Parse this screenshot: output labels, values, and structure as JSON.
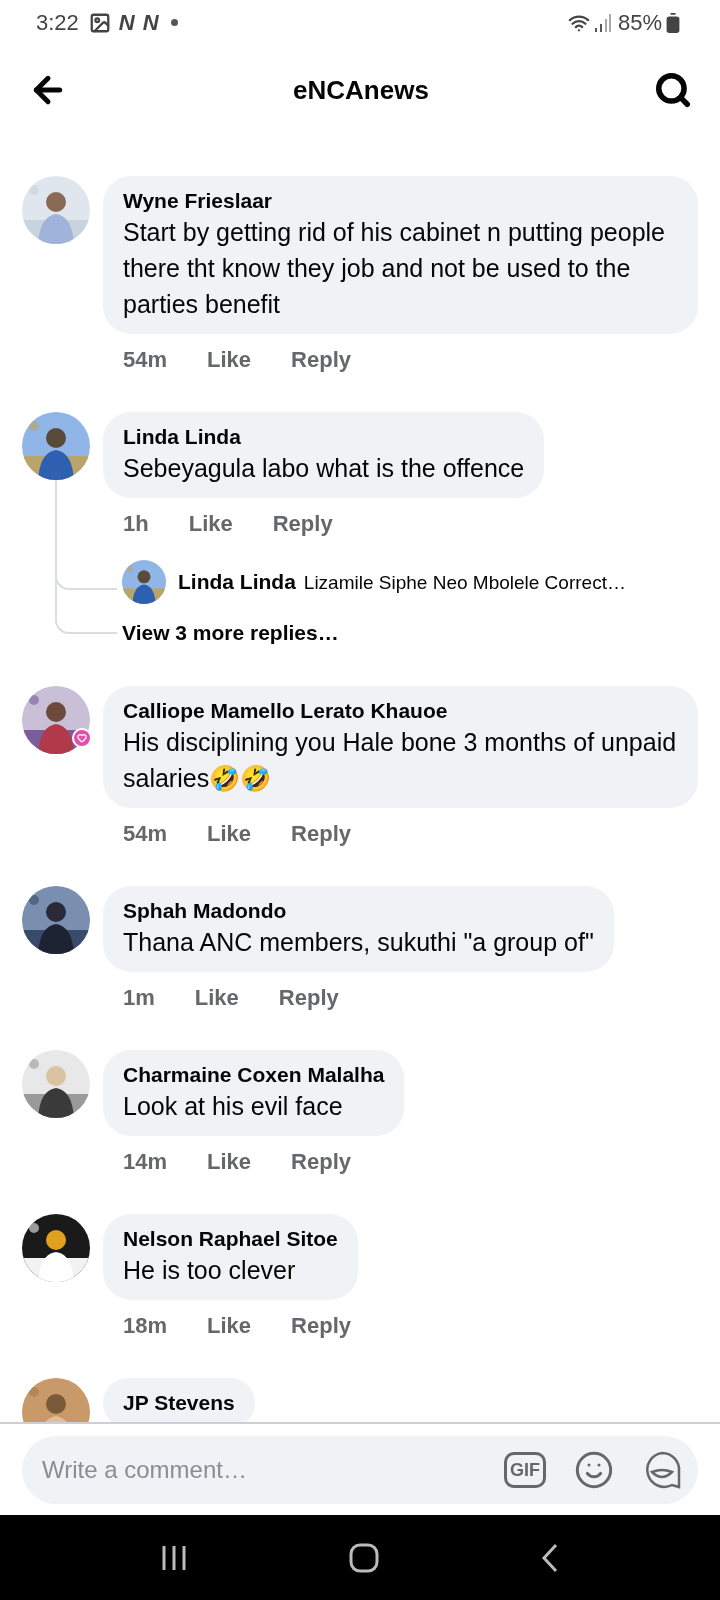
{
  "status_bar": {
    "time": "3:22",
    "notifications": [
      "N",
      "N"
    ],
    "battery": "85%"
  },
  "header": {
    "title": "eNCAnews"
  },
  "comments": [
    {
      "kind": "comment",
      "name": "Wyne Frieslaar",
      "text": "Start by getting rid of his cabinet n putting people there tht know they job and not be used to the parties benefit",
      "time": "54m",
      "like": "Like",
      "reply": "Reply",
      "heart_badge": false
    },
    {
      "kind": "thread",
      "name": "Linda Linda",
      "text": "Sebeyagula labo what is the offence",
      "time": "1h",
      "like": "Like",
      "reply": "Reply",
      "heart_badge": false,
      "replies": [
        {
          "name": "Linda Linda",
          "text": "Lizamile Siphe Neo Mbolele Correct…"
        }
      ],
      "more_replies": "View 3 more replies…"
    },
    {
      "kind": "comment",
      "name": "Calliope Mamello Lerato Khauoe",
      "text": "His disciplining you Hale bone 3 months of unpaid salaries🤣🤣",
      "time": "54m",
      "like": "Like",
      "reply": "Reply",
      "heart_badge": true
    },
    {
      "kind": "comment",
      "name": "Sphah Madondo",
      "text": "Thana ANC members, sukuthi \"a group of\"",
      "time": "1m",
      "like": "Like",
      "reply": "Reply",
      "heart_badge": false
    },
    {
      "kind": "comment",
      "name": "Charmaine Coxen Malalha",
      "text": "Look at his evil face",
      "time": "14m",
      "like": "Like",
      "reply": "Reply",
      "heart_badge": false
    },
    {
      "kind": "comment",
      "name": "Nelson Raphael Sitoe",
      "text": "He is too clever",
      "time": "18m",
      "like": "Like",
      "reply": "Reply",
      "heart_badge": false
    },
    {
      "kind": "comment",
      "name": "JP Stevens",
      "heart_badge": false
    }
  ],
  "composer": {
    "placeholder": "Write a comment…",
    "gif_label": "GIF"
  }
}
